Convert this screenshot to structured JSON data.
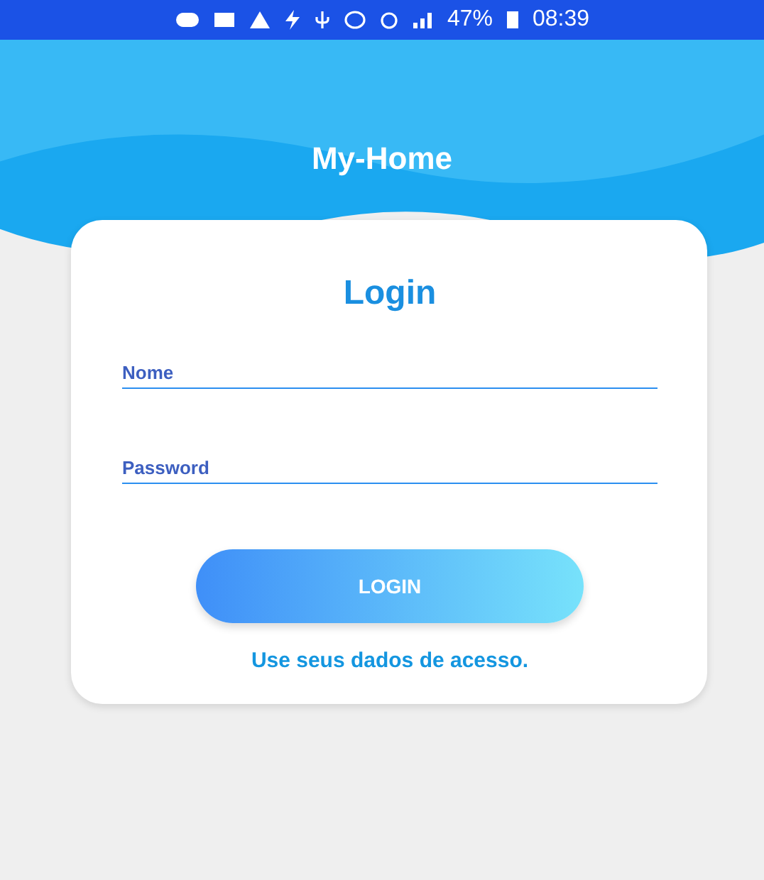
{
  "status_bar": {
    "battery": "47%",
    "time": "08:39"
  },
  "header": {
    "title": "My-Home"
  },
  "login_card": {
    "title": "Login",
    "fields": [
      {
        "placeholder": "Nome"
      },
      {
        "placeholder": "Password"
      }
    ],
    "button": "LOGIN",
    "hint": "Use seus dados de acesso."
  }
}
